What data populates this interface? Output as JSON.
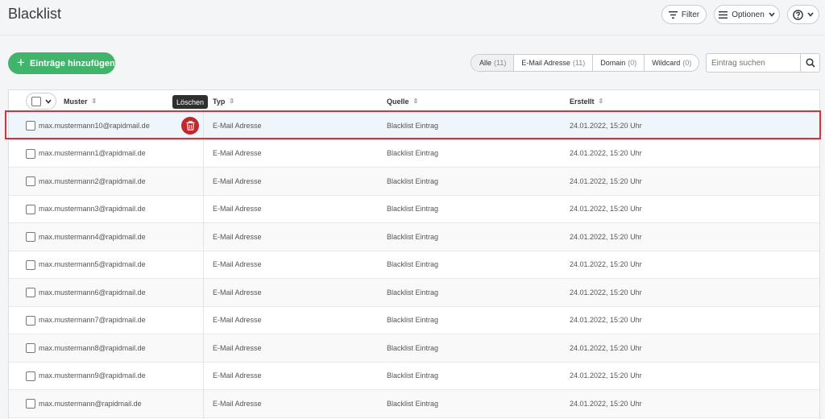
{
  "header": {
    "title": "Blacklist",
    "filter_label": "Filter",
    "options_label": "Optionen",
    "help_icon": "help-icon"
  },
  "toolbar": {
    "add_label": "Einträge hinzufügen",
    "segments": [
      {
        "label": "Alle",
        "count": "(11)"
      },
      {
        "label": "E-Mail Adresse",
        "count": "(11)"
      },
      {
        "label": "Domain",
        "count": "(0)"
      },
      {
        "label": "Wildcard",
        "count": "(0)"
      }
    ],
    "search_placeholder": "Eintrag suchen"
  },
  "table": {
    "columns": [
      "Muster",
      "Typ",
      "Quelle",
      "Erstellt"
    ],
    "tooltip": "Löschen",
    "rows": [
      {
        "muster": "max.mustermann10@rapidmail.de",
        "typ": "E-Mail Adresse",
        "quelle": "Blacklist Eintrag",
        "erstellt": "24.01.2022, 15:20 Uhr"
      },
      {
        "muster": "max.mustermann1@rapidmail.de",
        "typ": "E-Mail Adresse",
        "quelle": "Blacklist Eintrag",
        "erstellt": "24.01.2022, 15:20 Uhr"
      },
      {
        "muster": "max.mustermann2@rapidmail.de",
        "typ": "E-Mail Adresse",
        "quelle": "Blacklist Eintrag",
        "erstellt": "24.01.2022, 15:20 Uhr"
      },
      {
        "muster": "max.mustermann3@rapidmail.de",
        "typ": "E-Mail Adresse",
        "quelle": "Blacklist Eintrag",
        "erstellt": "24.01.2022, 15:20 Uhr"
      },
      {
        "muster": "max.mustermann4@rapidmail.de",
        "typ": "E-Mail Adresse",
        "quelle": "Blacklist Eintrag",
        "erstellt": "24.01.2022, 15:20 Uhr"
      },
      {
        "muster": "max.mustermann5@rapidmail.de",
        "typ": "E-Mail Adresse",
        "quelle": "Blacklist Eintrag",
        "erstellt": "24.01.2022, 15:20 Uhr"
      },
      {
        "muster": "max.mustermann6@rapidmail.de",
        "typ": "E-Mail Adresse",
        "quelle": "Blacklist Eintrag",
        "erstellt": "24.01.2022, 15:20 Uhr"
      },
      {
        "muster": "max.mustermann7@rapidmail.de",
        "typ": "E-Mail Adresse",
        "quelle": "Blacklist Eintrag",
        "erstellt": "24.01.2022, 15:20 Uhr"
      },
      {
        "muster": "max.mustermann8@rapidmail.de",
        "typ": "E-Mail Adresse",
        "quelle": "Blacklist Eintrag",
        "erstellt": "24.01.2022, 15:20 Uhr"
      },
      {
        "muster": "max.mustermann9@rapidmail.de",
        "typ": "E-Mail Adresse",
        "quelle": "Blacklist Eintrag",
        "erstellt": "24.01.2022, 15:20 Uhr"
      },
      {
        "muster": "max.mustermann@rapidmail.de",
        "typ": "E-Mail Adresse",
        "quelle": "Blacklist Eintrag",
        "erstellt": "24.01.2022, 15:20 Uhr"
      }
    ]
  },
  "colors": {
    "accent_green": "#3fb46a",
    "delete_red": "#c1272d",
    "highlight_red": "#d9303e"
  }
}
